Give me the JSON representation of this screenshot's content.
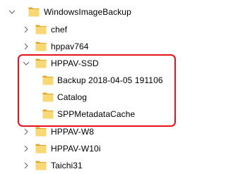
{
  "tree": {
    "items": [
      {
        "label": "WindowsImageBackup",
        "level": 0,
        "expanded": true,
        "icon": "folder-icon",
        "chevron": "chevron-down-icon"
      },
      {
        "label": "chef",
        "level": 1,
        "expanded": false,
        "icon": "folder-icon",
        "chevron": "chevron-right-icon"
      },
      {
        "label": "hppav764",
        "level": 1,
        "expanded": false,
        "icon": "folder-icon",
        "chevron": "chevron-right-icon"
      },
      {
        "label": "HPPAV-SSD",
        "level": 1,
        "expanded": true,
        "icon": "folder-icon",
        "chevron": "chevron-down-icon"
      },
      {
        "label": "Backup 2018-04-05 191106",
        "level": 2,
        "expanded": false,
        "icon": "folder-icon",
        "chevron": "none"
      },
      {
        "label": "Catalog",
        "level": 2,
        "expanded": false,
        "icon": "folder-icon",
        "chevron": "none"
      },
      {
        "label": "SPPMetadataCache",
        "level": 2,
        "expanded": false,
        "icon": "folder-icon",
        "chevron": "none"
      },
      {
        "label": "HPPAV-W8",
        "level": 1,
        "expanded": false,
        "icon": "folder-icon",
        "chevron": "chevron-right-icon"
      },
      {
        "label": "HPPAV-W10i",
        "level": 1,
        "expanded": false,
        "icon": "folder-icon",
        "chevron": "chevron-right-icon"
      },
      {
        "label": "Taichi31",
        "level": 1,
        "expanded": false,
        "icon": "folder-icon",
        "chevron": "chevron-right-icon"
      }
    ]
  },
  "colors": {
    "folder_body": "#f8d775",
    "folder_back": "#e0a526",
    "highlight_border": "#e8111a",
    "chevron": "#707070"
  }
}
